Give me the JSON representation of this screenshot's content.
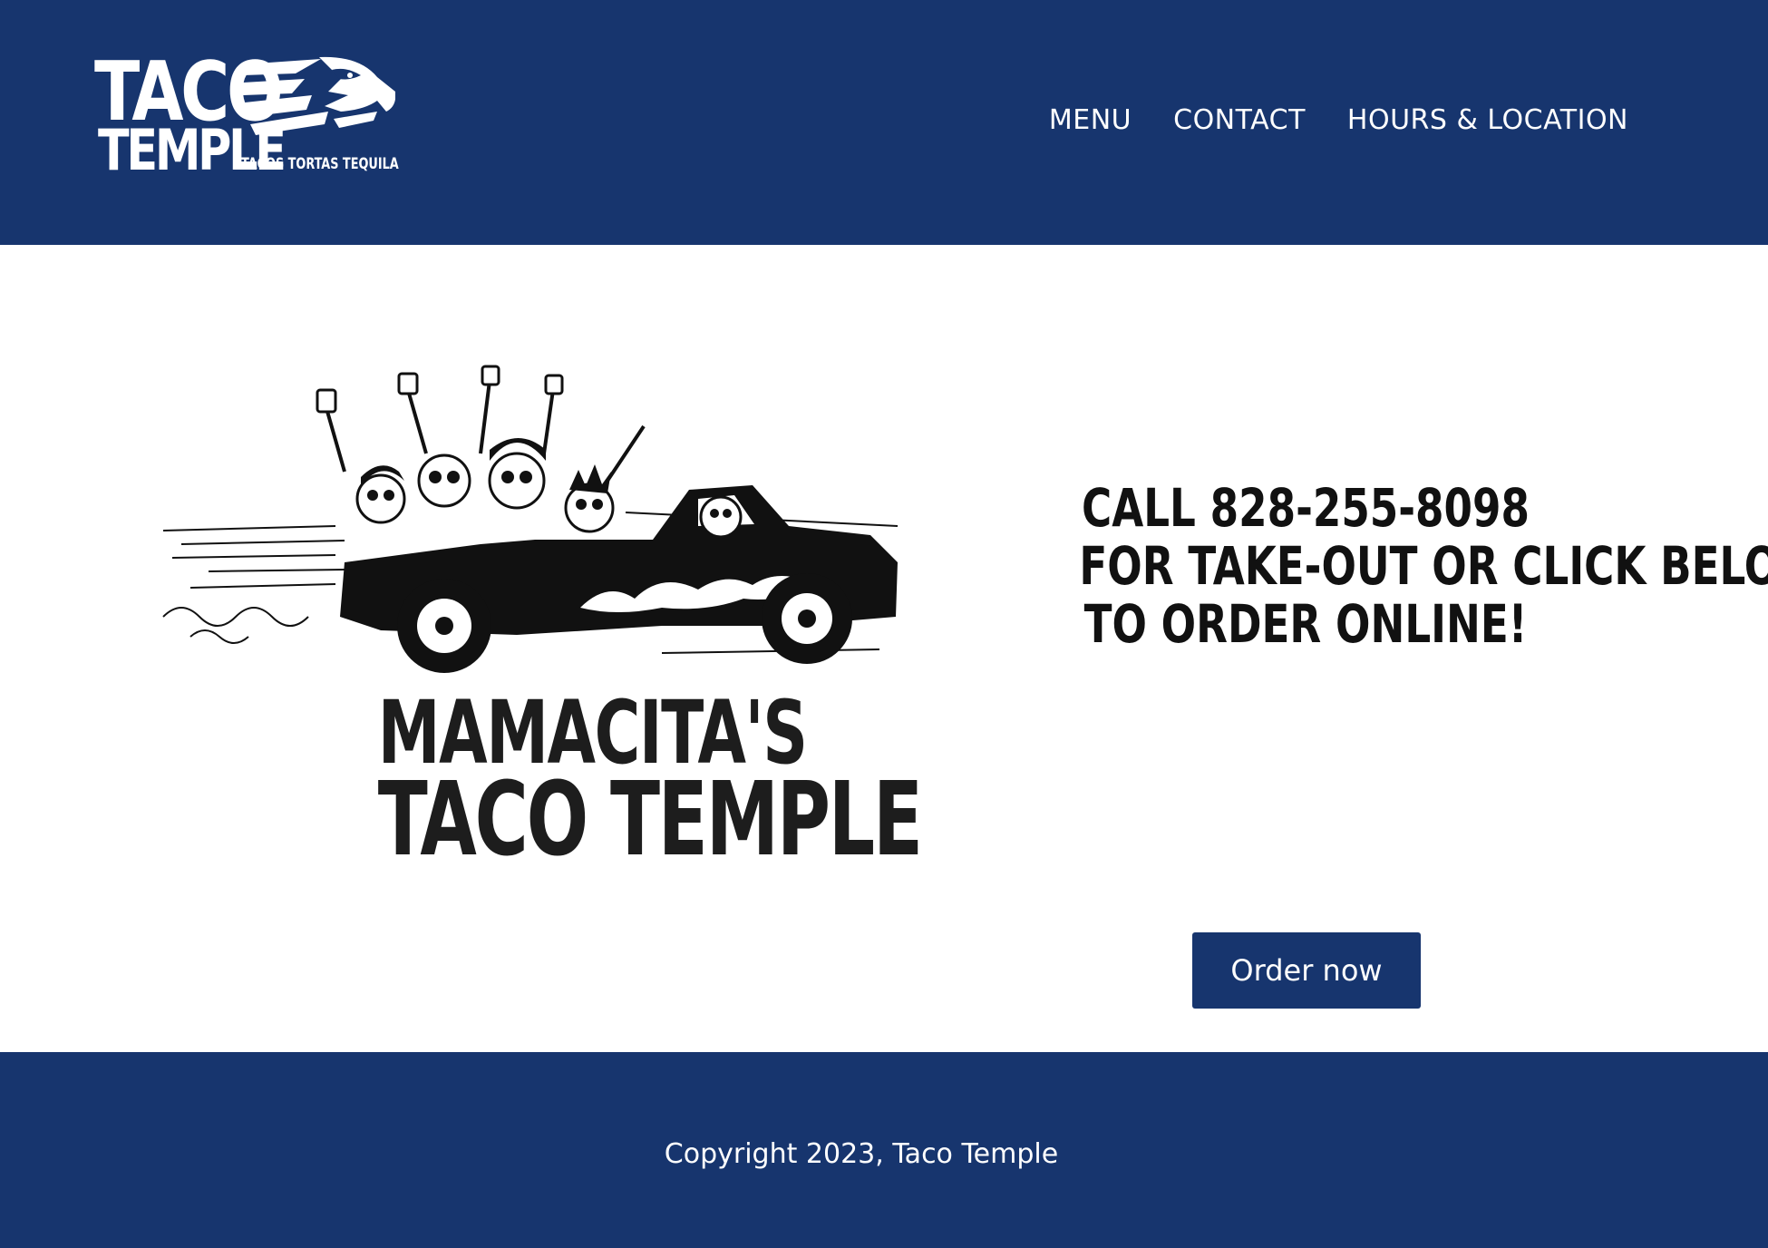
{
  "brand": {
    "logo_word_1": "TACO",
    "logo_word_2": "TEMPLE",
    "tagline": "TACOS TORTAS TEQUILA"
  },
  "nav": {
    "items": [
      {
        "label": "MENU"
      },
      {
        "label": "CONTACT"
      },
      {
        "label": "HOURS & LOCATION"
      }
    ]
  },
  "hero": {
    "illustration_title_line1": "MAMACITA'S",
    "illustration_title_line2": "TACO TEMPLE",
    "illustration_icon": "skeletons-in-car-illustration",
    "cta_lines": [
      "CALL 828-255-8098",
      "FOR TAKE-OUT OR CLICK BELOW",
      "TO ORDER ONLINE!"
    ],
    "order_button_label": "Order now"
  },
  "footer": {
    "copyright": "Copyright 2023, Taco Temple"
  },
  "colors": {
    "brand_blue": "#17356e",
    "text_dark": "#111111",
    "white": "#ffffff"
  }
}
